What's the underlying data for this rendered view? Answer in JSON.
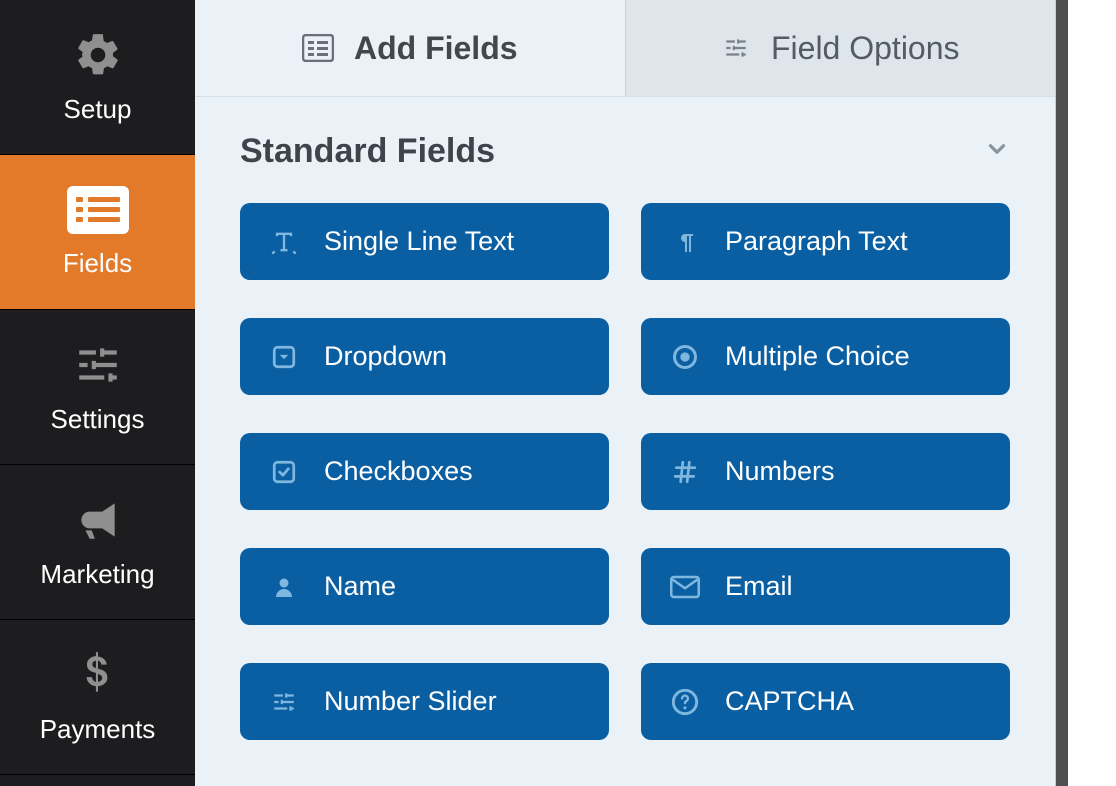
{
  "sidebar": {
    "items": [
      {
        "label": "Setup"
      },
      {
        "label": "Fields"
      },
      {
        "label": "Settings"
      },
      {
        "label": "Marketing"
      },
      {
        "label": "Payments"
      }
    ]
  },
  "tabs": {
    "add_fields": "Add Fields",
    "field_options": "Field Options"
  },
  "section": {
    "title": "Standard Fields"
  },
  "fields": {
    "single_line_text": "Single Line Text",
    "paragraph_text": "Paragraph Text",
    "dropdown": "Dropdown",
    "multiple_choice": "Multiple Choice",
    "checkboxes": "Checkboxes",
    "numbers": "Numbers",
    "name": "Name",
    "email": "Email",
    "number_slider": "Number Slider",
    "captcha": "CAPTCHA"
  }
}
